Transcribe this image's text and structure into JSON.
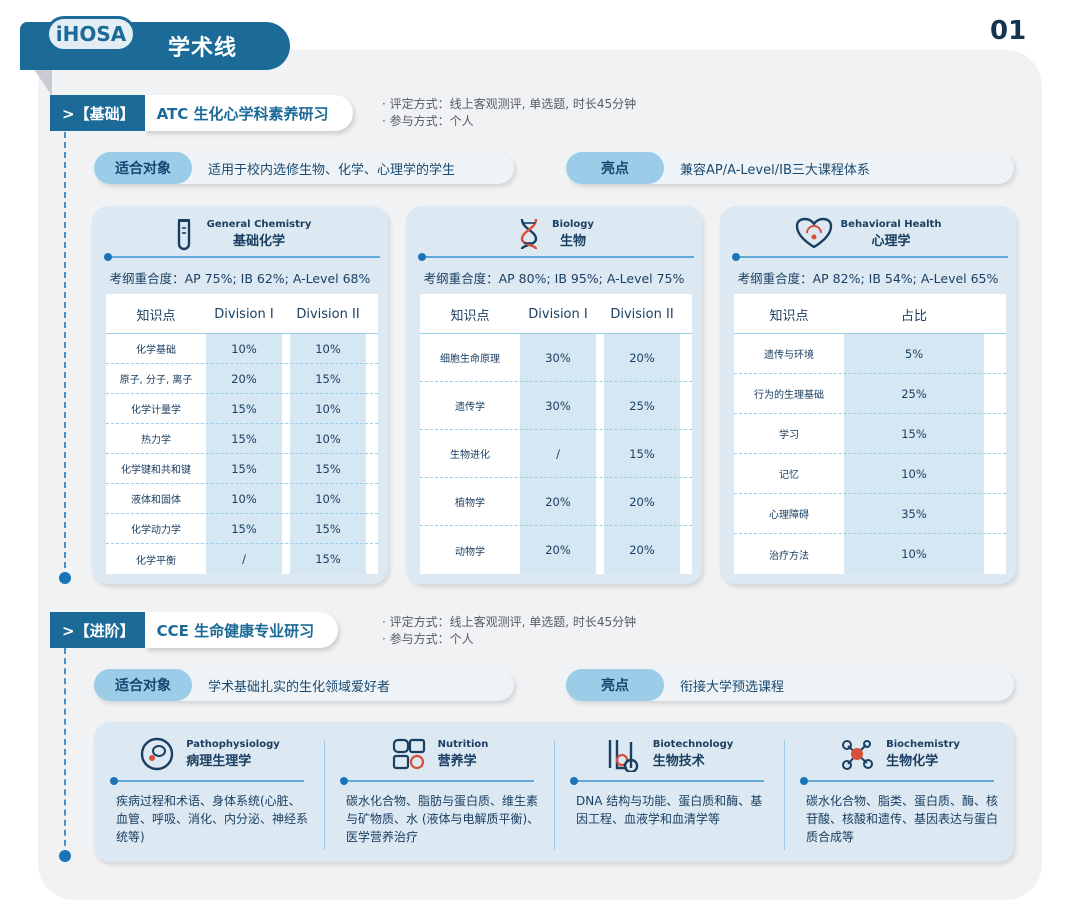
{
  "header": {
    "tag": "iHOSA",
    "title": "学术线",
    "page_number": "01"
  },
  "sections": [
    {
      "label": ">【基础】",
      "title": "ATC 生化心学科素养研习",
      "meta": [
        "· 评定方式：线上客观测评, 单选题, 时长45分钟",
        "· 参与方式：个人"
      ],
      "audience_tag": "适合对象",
      "audience_text": "适用于校内选修生物、化学、心理学的学生",
      "highlight_tag": "亮点",
      "highlight_text": "兼容AP/A-Level/IB三大课程体系"
    },
    {
      "label": ">【进阶】",
      "title": "CCE 生命健康专业研习",
      "meta": [
        "· 评定方式：线上客观测评, 单选题, 时长45分钟",
        "· 参与方式：个人"
      ],
      "audience_tag": "适合对象",
      "audience_text": "学术基础扎实的生化领域爱好者",
      "highlight_tag": "亮点",
      "highlight_text": "衔接大学预选课程"
    }
  ],
  "cards": [
    {
      "icon": "test-tube-icon",
      "en": "General Chemistry",
      "zh": "基础化学",
      "overlap": "考纲重合度：AP 75%; IB 62%; A-Level 68%",
      "headers": [
        "知识点",
        "Division I",
        "Division II"
      ],
      "rows": [
        [
          "化学基础",
          "10%",
          "10%"
        ],
        [
          "原子, 分子, 离子",
          "20%",
          "15%"
        ],
        [
          "化学计量学",
          "15%",
          "10%"
        ],
        [
          "热力学",
          "15%",
          "10%"
        ],
        [
          "化学键和共和键",
          "15%",
          "15%"
        ],
        [
          "液体和固体",
          "10%",
          "10%"
        ],
        [
          "化学动力学",
          "15%",
          "15%"
        ],
        [
          "化学平衡",
          "/",
          "15%"
        ]
      ]
    },
    {
      "icon": "dna-icon",
      "en": "Biology",
      "zh": "生物",
      "overlap": "考纲重合度：AP 80%; IB 95%; A-Level 75%",
      "headers": [
        "知识点",
        "Division I",
        "Division II"
      ],
      "rows": [
        [
          "细胞生命原理",
          "30%",
          "20%"
        ],
        [
          "遗传学",
          "30%",
          "25%"
        ],
        [
          "生物进化",
          "/",
          "15%"
        ],
        [
          "植物学",
          "20%",
          "20%"
        ],
        [
          "动物学",
          "20%",
          "20%"
        ]
      ]
    },
    {
      "icon": "heart-health-icon",
      "en": "Behavioral Health",
      "zh": "心理学",
      "overlap": "考纲重合度：AP 82%; IB 54%; A-Level 65%",
      "headers": [
        "知识点",
        "占比"
      ],
      "rows": [
        [
          "遗传与环境",
          "5%"
        ],
        [
          "行为的生理基础",
          "25%"
        ],
        [
          "学习",
          "15%"
        ],
        [
          "记忆",
          "10%"
        ],
        [
          "心理障碍",
          "35%"
        ],
        [
          "治疗方法",
          "10%"
        ]
      ]
    }
  ],
  "advanced": [
    {
      "icon": "cell-icon",
      "en": "Pathophysiology",
      "zh": "病理生理学",
      "desc": "疾病过程和术语、身体系统(心脏、血管、呼吸、消化、内分泌、神经系统等)"
    },
    {
      "icon": "nutrition-icon",
      "en": "Nutrition",
      "zh": "营养学",
      "desc": "碳水化合物、脂肪与蛋白质、维生素与矿物质、水 (液体与电解质平衡)、医学营养治疗"
    },
    {
      "icon": "lab-icon",
      "en": "Biotechnology",
      "zh": "生物技术",
      "desc": "DNA 结构与功能、蛋白质和酶、基因工程、血液学和血清学等"
    },
    {
      "icon": "molecule-icon",
      "en": "Biochemistry",
      "zh": "生物化学",
      "desc": "碳水化合物、脂类、蛋白质、酶、核苷酸、核酸和遗传、基因表达与蛋白质合成等"
    }
  ]
}
